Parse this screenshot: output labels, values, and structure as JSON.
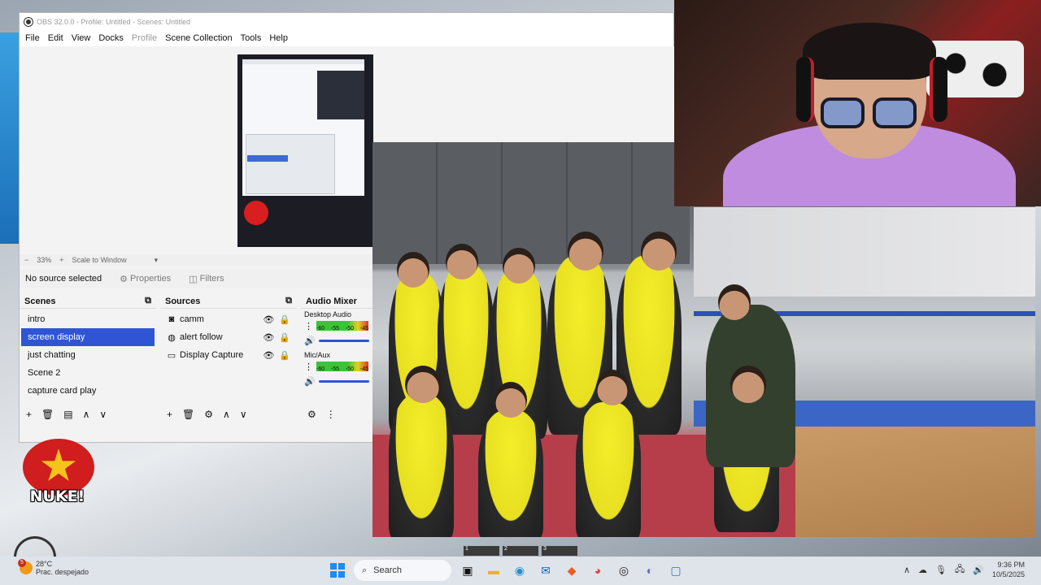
{
  "window": {
    "title": "OBS 32.0.0 - Profile: Untitled - Scenes: Untitled"
  },
  "menu": {
    "items": [
      "File",
      "Edit",
      "View",
      "Docks",
      "Profile",
      "Scene Collection",
      "Tools",
      "Help"
    ]
  },
  "preview": {
    "zoom": "33%",
    "scale_mode": "Scale to Window"
  },
  "properties_bar": {
    "status": "No source selected",
    "properties_label": "Properties",
    "filters_label": "Filters"
  },
  "scenes": {
    "header": "Scenes",
    "items": [
      "intro",
      "screen display",
      "just chatting",
      "Scene 2",
      "capture card play"
    ],
    "selected_index": 1
  },
  "sources": {
    "header": "Sources",
    "items": [
      {
        "name": "camm",
        "icon": "camera-icon"
      },
      {
        "name": "alert follow",
        "icon": "browser-icon"
      },
      {
        "name": "Display Capture",
        "icon": "monitor-icon"
      }
    ]
  },
  "audio_mixer": {
    "header": "Audio Mixer",
    "tracks": [
      {
        "name": "Desktop Audio",
        "ticks": [
          "-60",
          "-55",
          "-50",
          "-45"
        ]
      },
      {
        "name": "Mic/Aux",
        "ticks": [
          "-60",
          "-55",
          "-50",
          "-45"
        ]
      }
    ]
  },
  "overlay": {
    "nuke_text": "NUKE!"
  },
  "virtual_desktops": [
    "1",
    "2",
    "3"
  ],
  "taskbar": {
    "weather_temp": "28°C",
    "weather_desc": "Prac. despejado",
    "weather_badge": "5",
    "search_label": "Search",
    "time": "9:36 PM",
    "date": "10/5/2025"
  }
}
